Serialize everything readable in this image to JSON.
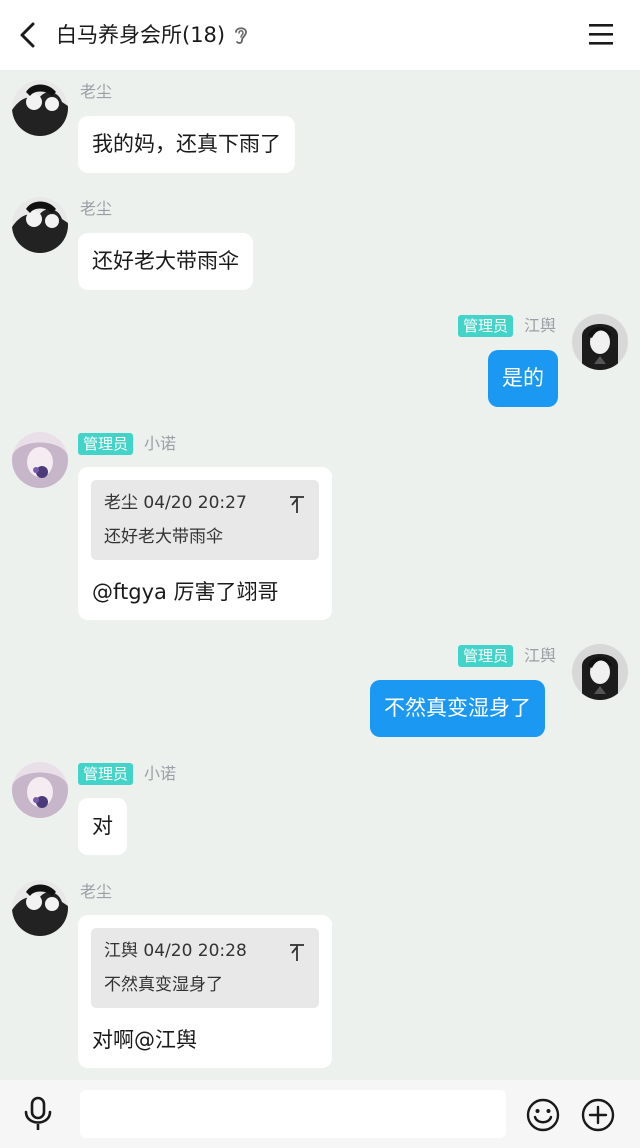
{
  "header": {
    "title": "白马养身会所(18)"
  },
  "messages": [
    {
      "sender": "老尘",
      "text": "我的妈，还真下雨了"
    },
    {
      "sender": "老尘",
      "text": "还好老大带雨伞"
    },
    {
      "badge": "管理员",
      "sender": "江舆",
      "text": "是的"
    },
    {
      "badge": "管理员",
      "sender": "小诺",
      "quote": {
        "meta": "老尘 04/20 20:27",
        "text": "还好老大带雨伞"
      },
      "text": "@ftgya 厉害了翊哥"
    },
    {
      "badge": "管理员",
      "sender": "江舆",
      "text": "不然真变湿身了"
    },
    {
      "badge": "管理员",
      "sender": "小诺",
      "text": "对"
    },
    {
      "sender": "老尘",
      "quote": {
        "meta": "江舆 04/20 20:28",
        "text": "不然真变湿身了"
      },
      "text": "对啊@江舆"
    }
  ],
  "input": {
    "value": "",
    "placeholder": ""
  },
  "colors": {
    "background": "#edf1ee",
    "self_bubble": "#1a98f2",
    "admin_badge": "#43d4c9"
  },
  "icons": {
    "back": "back-arrow-icon",
    "ear": "ear-icon",
    "menu": "menu-icon",
    "quote_top": "quote-top-icon",
    "mic": "microphone-icon",
    "emoji": "emoji-icon",
    "plus": "plus-icon"
  }
}
